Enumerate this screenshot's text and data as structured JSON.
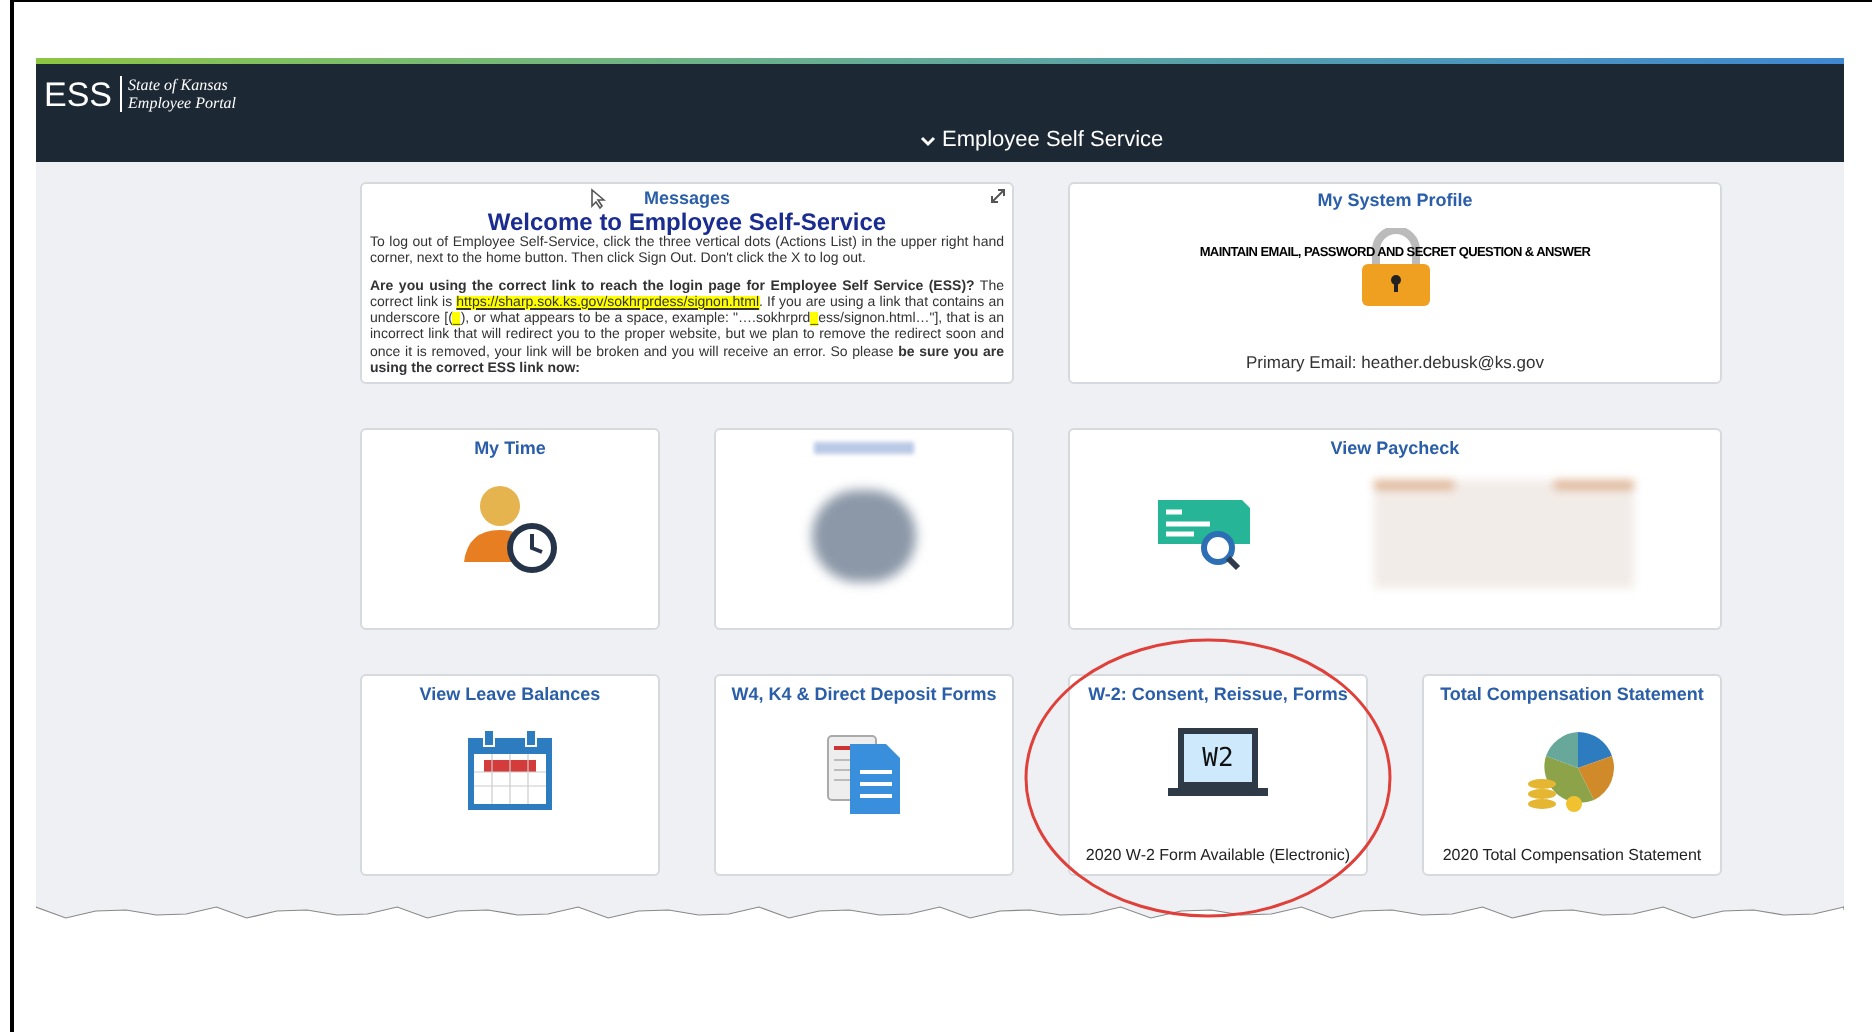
{
  "header": {
    "logo": "ESS",
    "org_line_1": "State of Kansas",
    "org_line_2": "Employee Portal",
    "nav_title": "Employee Self Service"
  },
  "tiles": [
    {
      "kind": "messages",
      "title": "Messages",
      "heading": "Welcome to Employee Self-Service",
      "paragraphs": [
        [
          {
            "kind": "text",
            "text": "To log out of Employee Self-Service, click the three vertical dots (Actions List) in the upper right hand corner, next to the home button. Then click Sign Out. Don't click the X to log out."
          }
        ],
        [
          {
            "kind": "text",
            "text": "**Are you using the correct link to reach the login page for Employee Self Service (ESS)?** The correct link is "
          },
          {
            "kind": "link",
            "text": "https://sharp.sok.ks.gov/sokhrprdess/signon.html"
          },
          {
            "kind": "text",
            "text": ". If you are using a link that contains an underscore [("
          },
          {
            "kind": "mark",
            "text": "_"
          },
          {
            "kind": "text",
            "text": "), or what appears to be a space, example: \"….sokhrprd"
          },
          {
            "kind": "mark",
            "text": "_"
          },
          {
            "kind": "text",
            "text": "ess/signon.html…\"], that is an incorrect link that will redirect you to the proper website, but we plan to remove the redirect soon and once it is removed, your link will be broken and you will receive an error. So please **be sure you are using the correct ESS link now:**"
          }
        ]
      ]
    },
    {
      "kind": "profile",
      "title": "My System Profile",
      "banner": "MAINTAIN EMAIL, PASSWORD AND SECRET QUESTION & ANSWER",
      "footer": "Primary Email: heather.debusk@ks.gov"
    },
    {
      "kind": "timesheet",
      "title": "My Time"
    },
    {
      "kind": "blurred"
    },
    {
      "kind": "paycheck",
      "title": "View Paycheck"
    },
    {
      "kind": "leave",
      "title": "View Leave Balances"
    },
    {
      "kind": "forms",
      "title": "W4, K4 & Direct Deposit Forms"
    },
    {
      "kind": "w2",
      "title": "W-2: Consent, Reissue, Forms",
      "screen_text": "W2",
      "footer": "2020 W-2 Form Available (Electronic)",
      "circled": true
    },
    {
      "kind": "compensation",
      "title": "Total Compensation Statement",
      "footer": "2020 Total Compensation Statement"
    }
  ]
}
